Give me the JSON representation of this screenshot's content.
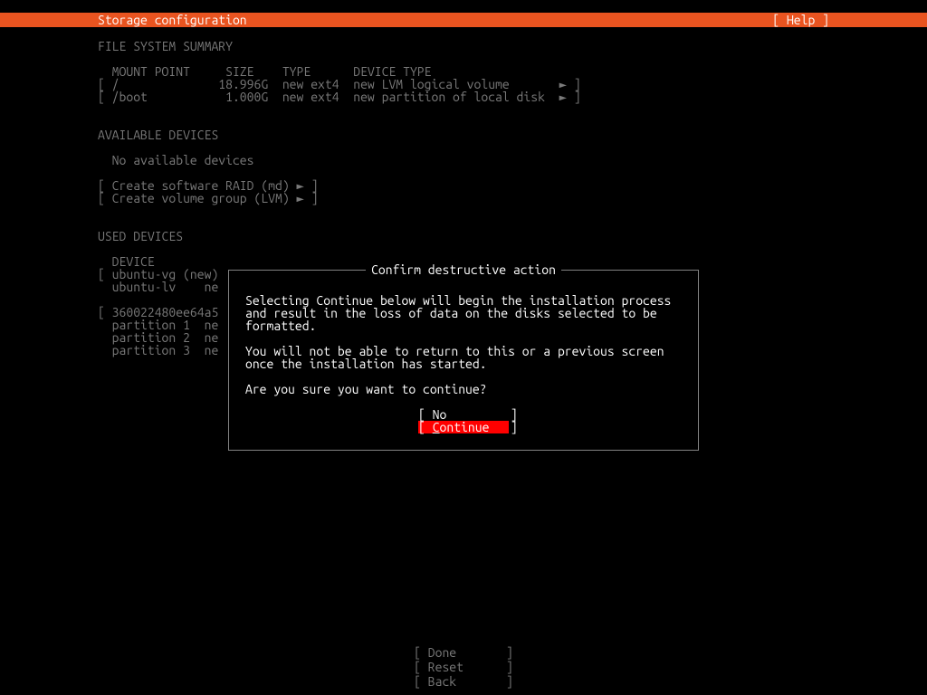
{
  "header": {
    "title": "Storage configuration",
    "help": "[ Help ]"
  },
  "sections": {
    "fssummary": {
      "heading": "FILE SYSTEM SUMMARY",
      "columns": "  MOUNT POINT     SIZE    TYPE      DEVICE TYPE",
      "rows": [
        "[ /              18.996G  new ext4  new LVM logical volume       ► ]",
        "[ /boot           1.000G  new ext4  new partition of local disk  ► ]"
      ]
    },
    "available": {
      "heading": "AVAILABLE DEVICES",
      "none": "  No available devices",
      "actions": [
        "[ Create software RAID (md) ► ]",
        "[ Create volume group (LVM) ► ]"
      ]
    },
    "used": {
      "heading": "USED DEVICES",
      "columns": "  DEVICE",
      "rows": [
        "[ ubuntu-vg (new)",
        "  ubuntu-lv    ne",
        "",
        "[ 360022480ee64a5",
        "  partition 1  ne",
        "  partition 2  ne",
        "  partition 3  ne"
      ]
    }
  },
  "footer": {
    "done": "[ Done       ]",
    "reset": "[ Reset      ]",
    "back": "[ Back       ]"
  },
  "dialog": {
    "title": "Confirm destructive action",
    "para1": "Selecting Continue below will begin the installation process and result in the loss of data on the disks selected to be formatted.",
    "para2": "You will not be able to return to this or a previous screen once the installation has started.",
    "para3": "Are you sure you want to continue?",
    "no": "[ No         ]",
    "continue_pre": "[ ",
    "continue_letter": "C",
    "continue_rest": "ontinue   ]"
  }
}
